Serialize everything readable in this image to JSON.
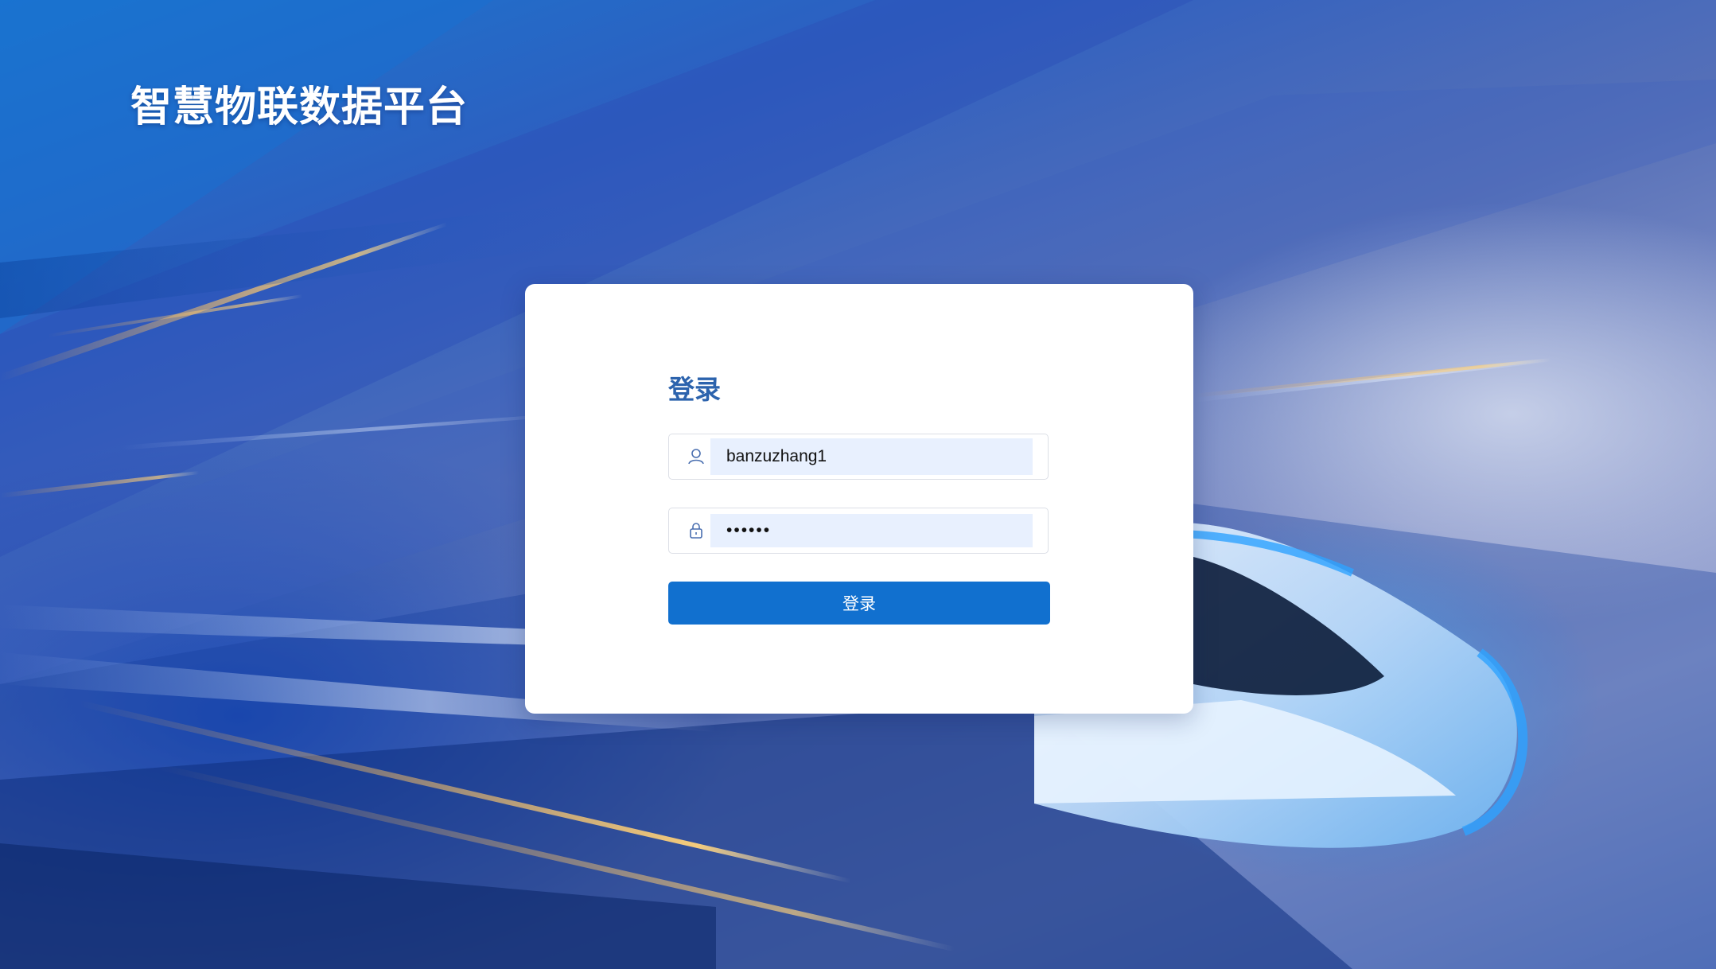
{
  "brand": {
    "title": "智慧物联数据平台"
  },
  "login": {
    "heading": "登录",
    "username": {
      "value": "banzuzhang1",
      "icon": "user-icon"
    },
    "password": {
      "value": "••••••",
      "icon": "lock-icon"
    },
    "submit_label": "登录"
  },
  "colors": {
    "accent": "#1170cf",
    "heading": "#2c63ad",
    "autofill_bg": "#e8f0fe"
  }
}
